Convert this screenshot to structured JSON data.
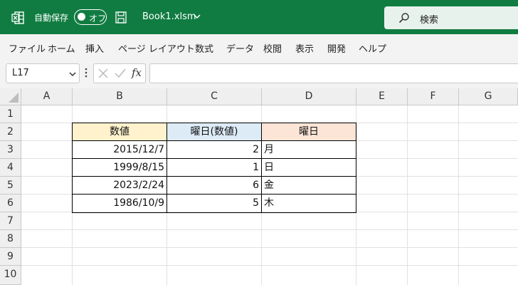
{
  "titlebar": {
    "autosave_label": "自動保存",
    "toggle_state": "オフ",
    "filename": "Book1.xlsm",
    "search_placeholder": "検索"
  },
  "menu": [
    "ファイル",
    "ホーム",
    "挿入",
    "ページ レイアウト",
    "数式",
    "データ",
    "校閲",
    "表示",
    "開発",
    "ヘルプ"
  ],
  "formula_bar": {
    "name_box": "L17",
    "fx_label": "fx",
    "formula_value": ""
  },
  "columns": [
    "A",
    "B",
    "C",
    "D",
    "E",
    "F",
    "G"
  ],
  "rows": [
    "1",
    "2",
    "3",
    "4",
    "5",
    "6",
    "7",
    "8",
    "9",
    "10"
  ],
  "table": {
    "headers": [
      "数値",
      "曜日(数値)",
      "曜日"
    ],
    "header_colors": [
      "#fff2cc",
      "#ddebf7",
      "#fce4d6"
    ],
    "rows": [
      [
        "2015/12/7",
        "2",
        "月"
      ],
      [
        "1999/8/15",
        "1",
        "日"
      ],
      [
        "2023/2/24",
        "6",
        "金"
      ],
      [
        "1986/10/9",
        "5",
        "木"
      ]
    ]
  },
  "colors": {
    "excel_green": "#107c41",
    "search_bg": "#e8f2ec"
  }
}
